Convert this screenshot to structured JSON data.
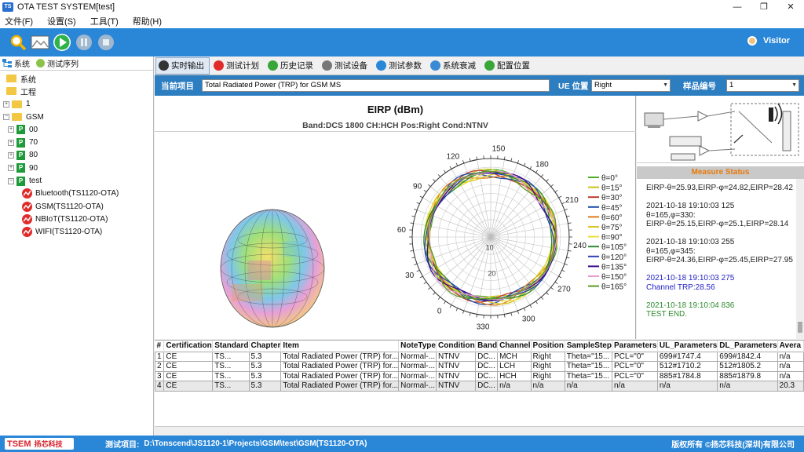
{
  "window": {
    "title": "OTA TEST SYSTEM[test]",
    "icon_label": "TS"
  },
  "menu": [
    "文件(F)",
    "设置(S)",
    "工具(T)",
    "帮助(H)"
  ],
  "toolbar": {
    "user": "Visitor"
  },
  "left_panel": {
    "tabs": [
      "系统",
      "测试序列"
    ],
    "tree": [
      {
        "label": "系统",
        "type": "folder",
        "level": 0,
        "expander": ""
      },
      {
        "label": "工程",
        "type": "folder",
        "level": 0,
        "expander": ""
      },
      {
        "label": "1",
        "type": "folder",
        "level": 0,
        "expander": "+"
      },
      {
        "label": "GSM",
        "type": "folder",
        "level": 0,
        "expander": "−"
      },
      {
        "label": "00",
        "type": "group",
        "level": 1,
        "expander": "+"
      },
      {
        "label": "70",
        "type": "group",
        "level": 1,
        "expander": "+"
      },
      {
        "label": "80",
        "type": "group",
        "level": 1,
        "expander": "+"
      },
      {
        "label": "90",
        "type": "group",
        "level": 1,
        "expander": "+"
      },
      {
        "label": "test",
        "type": "group",
        "level": 1,
        "expander": "−"
      },
      {
        "label": "Bluetooth(TS1120-OTA)",
        "type": "item",
        "level": 2,
        "expander": ""
      },
      {
        "label": "GSM(TS1120-OTA)",
        "type": "item",
        "level": 2,
        "expander": ""
      },
      {
        "label": "NBIoT(TS1120-OTA)",
        "type": "item",
        "level": 2,
        "expander": ""
      },
      {
        "label": "WIFI(TS1120-OTA)",
        "type": "item",
        "level": 2,
        "expander": ""
      }
    ]
  },
  "main_tabs": [
    {
      "label": "实时输出",
      "active": true,
      "color": "#333333"
    },
    {
      "label": "测试计划",
      "active": false,
      "color": "#e02b2b"
    },
    {
      "label": "历史记录",
      "active": false,
      "color": "#3aa63a"
    },
    {
      "label": "测试设备",
      "active": false,
      "color": "#777777"
    },
    {
      "label": "测试参数",
      "active": false,
      "color": "#2a86d6"
    },
    {
      "label": "系统衰减",
      "active": false,
      "color": "#3a8ad6"
    },
    {
      "label": "配置位置",
      "active": false,
      "color": "#3aa63a"
    }
  ],
  "project_bar": {
    "current_label": "当前项目",
    "current_value": "Total Radiated Power (TRP) for GSM MS",
    "ue_label": "UE 位置",
    "ue_value": "Right",
    "sample_label": "样品编号",
    "sample_value": "1"
  },
  "chart": {
    "title": "EIRP (dBm)",
    "subtitle": "Band:DCS 1800  CH:HCH Pos:Right  Cond:NTNV"
  },
  "chart_data": {
    "type": "polar-line",
    "title": "EIRP (dBm)",
    "subtitle": "Band:DCS 1800  CH:HCH Pos:Right  Cond:NTNV",
    "angle_ticks": [
      0,
      30,
      60,
      90,
      120,
      150,
      180,
      210,
      240,
      270,
      300,
      330
    ],
    "radial_ticks": [
      10,
      20,
      30
    ],
    "series": [
      {
        "name": "θ=0°",
        "color": "#4caf2a"
      },
      {
        "name": "θ=15°",
        "color": "#c9c21a"
      },
      {
        "name": "θ=30°",
        "color": "#c0392b"
      },
      {
        "name": "θ=45°",
        "color": "#1f4fa8"
      },
      {
        "name": "θ=60°",
        "color": "#e07b18"
      },
      {
        "name": "θ=75°",
        "color": "#d8c51e"
      },
      {
        "name": "θ=90°",
        "color": "#e8de3a"
      },
      {
        "name": "θ=105°",
        "color": "#2e8b2e"
      },
      {
        "name": "θ=120°",
        "color": "#2a3fb8"
      },
      {
        "name": "θ=135°",
        "color": "#3a0a8a"
      },
      {
        "name": "θ=150°",
        "color": "#e89ad0"
      },
      {
        "name": "θ=165°",
        "color": "#5a9a2a"
      }
    ],
    "approx_radius_value": 28
  },
  "measure_status": {
    "header": "Measure Status",
    "log": [
      {
        "lines": [
          "EIRP-θ=25.93,EIRP-φ=24.82,EIRP=28.42"
        ],
        "color": "#222222"
      },
      {
        "lines": [
          "2021-10-18 19:10:03 125",
          "θ=165,φ=330:",
          "EIRP-θ=25.15,EIRP-φ=25.1,EIRP=28.14"
        ],
        "color": "#222222"
      },
      {
        "lines": [
          "2021-10-18 19:10:03 255",
          "θ=165,φ=345:",
          "EIRP-θ=24.36,EIRP-φ=25.45,EIRP=27.95"
        ],
        "color": "#222222"
      },
      {
        "lines": [
          "2021-10-18 19:10:03 275",
          "Channel TRP:28.56"
        ],
        "color": "#2323c8"
      },
      {
        "lines": [
          "2021-10-18 19:10:04 836",
          "TEST END."
        ],
        "color": "#2e8b2e"
      }
    ]
  },
  "table": {
    "headers": [
      "#",
      "Certification",
      "Standard",
      "Chapter",
      "Item",
      "NoteType",
      "Condition",
      "Band",
      "Channel",
      "Position",
      "SampleStep",
      "Parameters",
      "UL_Parameters",
      "DL_Parameters",
      "Avera"
    ],
    "rows": [
      [
        "1",
        "CE",
        "TS...",
        "5.3",
        "Total Radiated Power (TRP) for...",
        "Normal-...",
        "NTNV",
        "DC...",
        "MCH",
        "Right",
        "Theta=\"15...",
        "PCL=\"0\"",
        "699#1747.4",
        "699#1842.4",
        "n/a"
      ],
      [
        "2",
        "CE",
        "TS...",
        "5.3",
        "Total Radiated Power (TRP) for...",
        "Normal-...",
        "NTNV",
        "DC...",
        "LCH",
        "Right",
        "Theta=\"15...",
        "PCL=\"0\"",
        "512#1710.2",
        "512#1805.2",
        "n/a"
      ],
      [
        "3",
        "CE",
        "TS...",
        "5.3",
        "Total Radiated Power (TRP) for...",
        "Normal-...",
        "NTNV",
        "DC...",
        "HCH",
        "Right",
        "Theta=\"15...",
        "PCL=\"0\"",
        "885#1784.8",
        "885#1879.8",
        "n/a"
      ],
      [
        "4",
        "CE",
        "TS...",
        "5.3",
        "Total Radiated Power (TRP) for...",
        "Normal-...",
        "NTNV",
        "DC...",
        "n/a",
        "n/a",
        "n/a",
        "n/a",
        "n/a",
        "n/a",
        "20.3"
      ]
    ]
  },
  "statusbar": {
    "logo_mark": "TSEM",
    "logo_text": "扬芯科技",
    "project_label": "测试项目:",
    "project_path": "D:\\Tonscend\\JS1120-1\\Projects\\GSM\\test\\GSM(TS1120-OTA)",
    "copyright": "版权所有 ©扬芯科技(深圳)有限公司"
  }
}
